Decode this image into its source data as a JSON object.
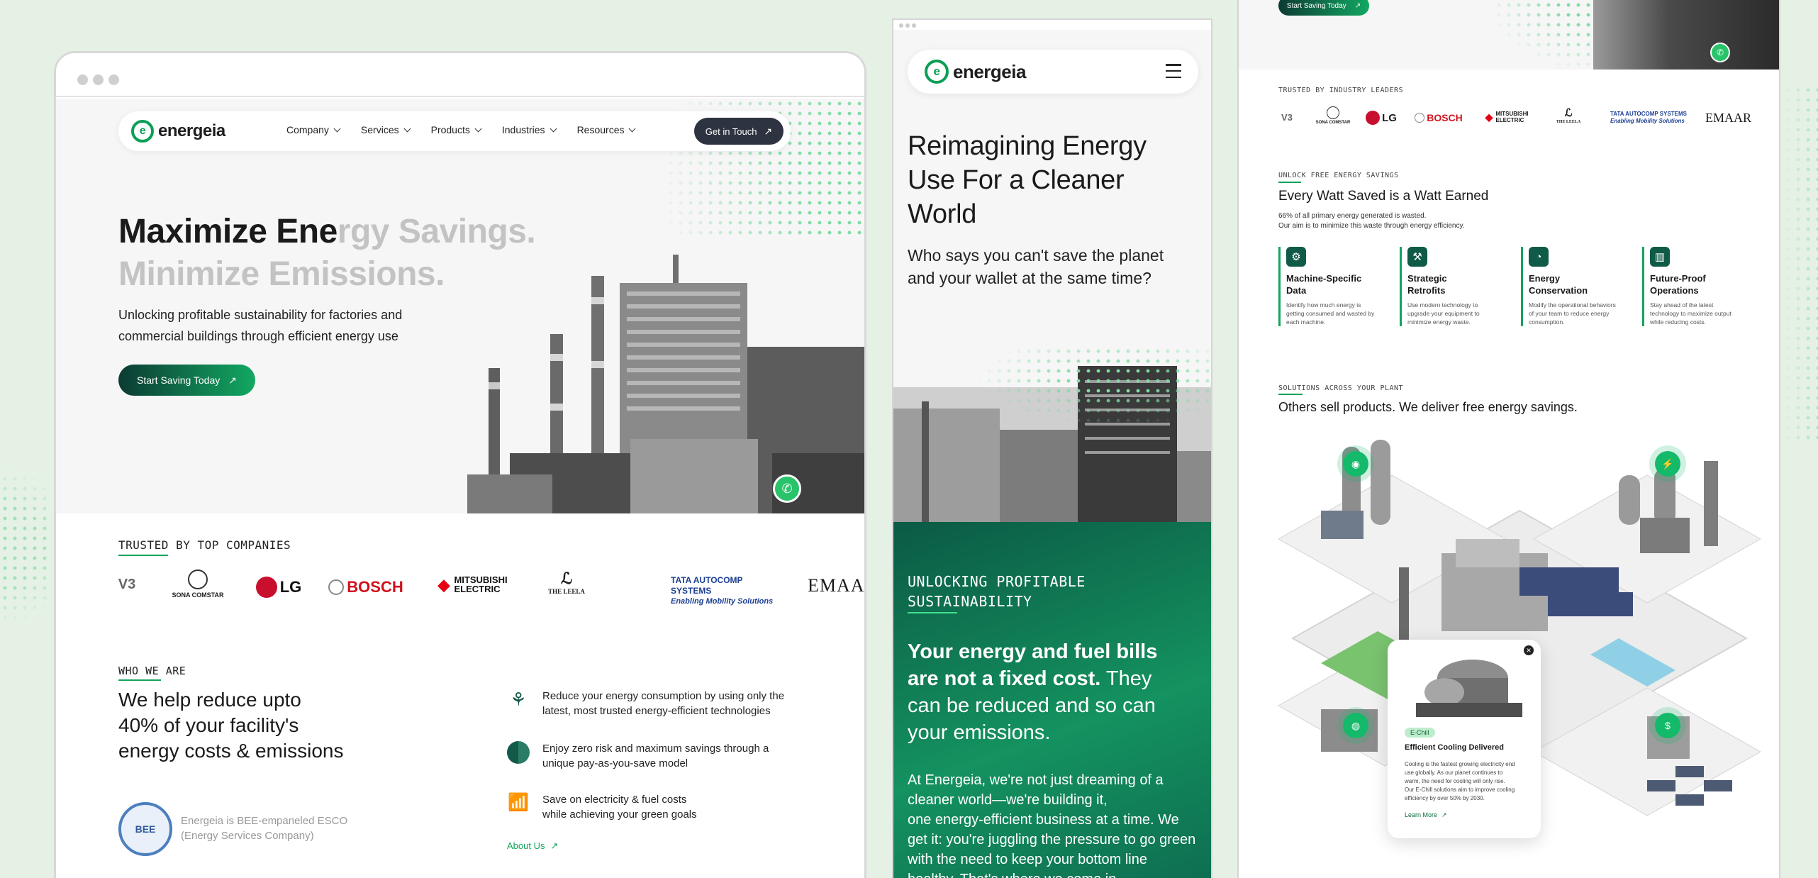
{
  "brand": {
    "name": "energeia",
    "accent": "#0b9f55",
    "dark": "#0c3b33"
  },
  "desktop": {
    "nav": [
      {
        "label": "Company"
      },
      {
        "label": "Services"
      },
      {
        "label": "Products"
      },
      {
        "label": "Industries"
      },
      {
        "label": "Resources"
      }
    ],
    "cta_nav": "Get in Touch",
    "hero": {
      "line1_dark": "Maximize Ene",
      "line1_light": "rgy Savings.",
      "line2": "Minimize Emissions.",
      "subtitle_l1": "Unlocking profitable sustainability for factories and",
      "subtitle_l2": "commercial buildings through efficient energy use",
      "cta": "Start Saving Today"
    },
    "trusted_label": "TRUSTED BY TOP COMPANIES",
    "logos": [
      "V3",
      "SONA COMSTAR",
      "LG",
      "BOSCH",
      "MITSUBISHI ELECTRIC",
      "THE LEELA",
      "TATA AUTOCOMP SYSTEMS",
      "Enabling Mobility Solutions",
      "EMAAR"
    ],
    "who": {
      "label": "WHO WE ARE",
      "h_l1": "We help reduce upto",
      "h_l2": "40% of your facility's",
      "h_l3": "energy costs & emissions",
      "points": [
        {
          "l1": "Reduce your energy consumption by using only the",
          "l2": "latest, most trusted energy-efficient technologies"
        },
        {
          "l1": "Enjoy zero risk and maximum savings through a",
          "l2": "unique pay-as-you-save model"
        },
        {
          "l1": "Save on electricity & fuel costs",
          "l2": "while achieving your green goals"
        }
      ],
      "bee_l1": "Energeia is BEE-empaneled ESCO",
      "bee_l2": "(Energy Services Company)",
      "about": "About Us"
    }
  },
  "mobile": {
    "h_l1": "Reimagining Energy",
    "h_l2": "Use For a Cleaner",
    "h_l3": "World",
    "sub_l1": "Who says you can't save the planet",
    "sub_l2": "and your wallet at the same time?",
    "label_l1": "UNLOCKING PROFITABLE",
    "label_l2": "SUSTAINABILITY",
    "bold_l1": "Your energy and fuel bills",
    "bold_l2": "are not a fixed cost.",
    "rest_l2": " They",
    "rest_l3": "can be reduced and so can",
    "rest_l4": "your emissions.",
    "body": [
      "At Energeia, we're not just dreaming of a",
      "cleaner world—we're building it,",
      "one energy-efficient business at a time. We",
      "get it: you're juggling the pressure to go green",
      "with the need to keep your bottom line",
      "healthy. That's where we come in."
    ]
  },
  "tablet": {
    "cta": "Start Saving Today",
    "trusted_label": "TRUSTED BY INDUSTRY LEADERS",
    "logos": [
      "V3",
      "SONA COMSTAR",
      "LG",
      "BOSCH",
      "MITSUBISHI ELECTRIC",
      "THE LEELA",
      "TATA AUTOCOMP SYSTEMS",
      "Enabling Mobility Solutions",
      "EMAAR"
    ],
    "unlock_label": "UNLOCK FREE ENERGY SAVINGS",
    "unlock_title": "Every Watt Saved is a Watt Earned",
    "unlock_sub1": "66% of all primary energy generated is wasted.",
    "unlock_sub2": "Our aim is to minimize this waste through energy efficiency.",
    "features": [
      {
        "t1": "Machine-Specific",
        "t2": "Data",
        "s": [
          "Identify how much energy is",
          "getting consumed and wasted by",
          "each machine."
        ]
      },
      {
        "t1": "Strategic",
        "t2": "Retrofits",
        "s": [
          "Use modern technology to",
          "upgrade your equipment to",
          "minimize energy waste."
        ]
      },
      {
        "t1": "Energy",
        "t2": "Conservation",
        "s": [
          "Modify the operational behaviors",
          "of your team to reduce energy",
          "consumption."
        ]
      },
      {
        "t1": "Future-Proof",
        "t2": "Operations",
        "s": [
          "Stay ahead of the latest",
          "technology to maximize output",
          "while reducing costs."
        ]
      }
    ],
    "solutions_label": "SOLUTIONS ACROSS YOUR PLANT",
    "solutions_title": "Others sell products. We deliver free energy savings.",
    "card": {
      "badge": "E-Chill",
      "title": "Efficient Cooling Delivered",
      "body": [
        "Cooling is the fastest growing electricity end",
        "use globally. As our planet continues to",
        "warm, the need for cooling will only rise.",
        "Our E-Chill solutions aim to improve cooling",
        "efficiency by over 50% by 2030."
      ],
      "link": "Learn More"
    }
  }
}
